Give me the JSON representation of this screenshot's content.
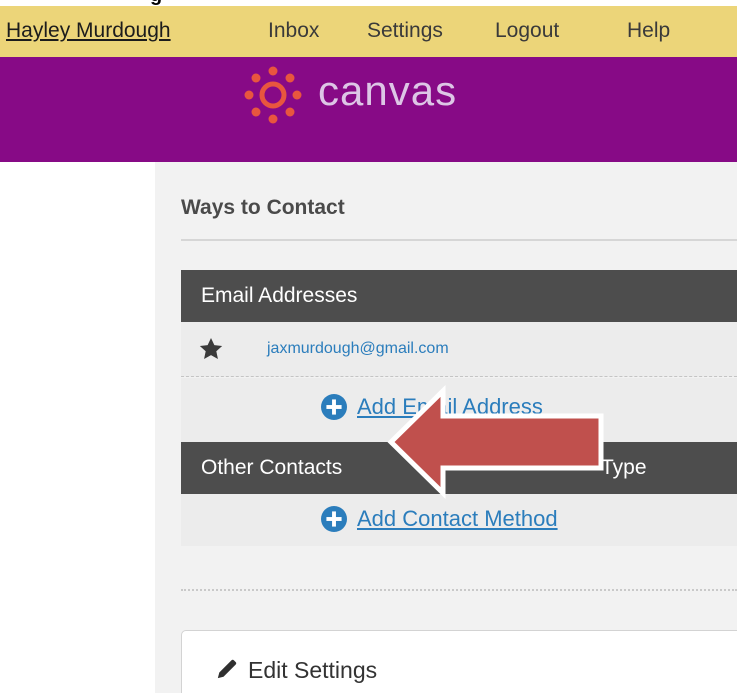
{
  "topnav": {
    "user": "Hayley Murdough",
    "inbox": "Inbox",
    "settings": "Settings",
    "logout": "Logout",
    "help": "Help"
  },
  "brand": {
    "name": "canvas",
    "bar_color": "#870a86",
    "nav_color": "#ecd579"
  },
  "contact": {
    "title": "Ways to Contact",
    "email_header": "Email Addresses",
    "email_value": "jaxmurdough@gmail.com",
    "add_email_label": "Add Email Address",
    "other_header": "Other Contacts",
    "type_header": "Type",
    "add_contact_label": "Add Contact Method"
  },
  "edit": {
    "label": "Edit Settings"
  },
  "icons": {
    "logo": "canvas-logo-icon",
    "star": "star-icon",
    "plus": "plus-circle-icon",
    "pencil": "pencil-icon",
    "arrow": "arrow-left-annotation"
  },
  "colors": {
    "link": "#2b7dbc",
    "header_dark": "#4d4d4d",
    "arrow_fill": "#c0504d"
  }
}
